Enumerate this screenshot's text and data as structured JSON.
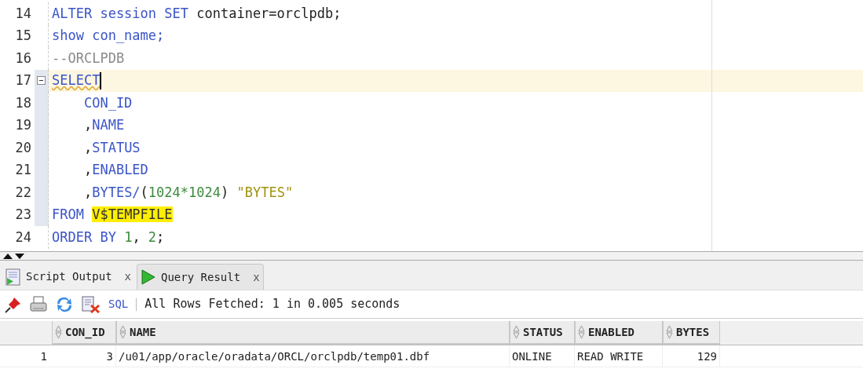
{
  "editor": {
    "lines": [
      {
        "number": "14",
        "current": false,
        "fold": false,
        "in_block": false,
        "tokens": [
          {
            "kind": "keyword",
            "text": "ALTER session SET "
          },
          {
            "kind": "plain",
            "text": "container=orclpdb;"
          }
        ]
      },
      {
        "number": "15",
        "current": false,
        "fold": false,
        "in_block": false,
        "tokens": [
          {
            "kind": "keyword",
            "text": "show con_name;"
          }
        ]
      },
      {
        "number": "16",
        "current": false,
        "fold": false,
        "in_block": false,
        "tokens": [
          {
            "kind": "comment",
            "text": "--ORCLPDB"
          }
        ]
      },
      {
        "number": "17",
        "current": true,
        "fold": true,
        "in_block": true,
        "tokens": [
          {
            "kind": "squiggle",
            "text": "SELECT"
          }
        ]
      },
      {
        "number": "18",
        "current": false,
        "fold": false,
        "in_block": true,
        "tokens": [
          {
            "kind": "keyword",
            "text": "    CON_ID"
          }
        ]
      },
      {
        "number": "19",
        "current": false,
        "fold": false,
        "in_block": true,
        "tokens": [
          {
            "kind": "plain",
            "text": "    ,"
          },
          {
            "kind": "keyword",
            "text": "NAME"
          }
        ]
      },
      {
        "number": "20",
        "current": false,
        "fold": false,
        "in_block": true,
        "tokens": [
          {
            "kind": "plain",
            "text": "    ,"
          },
          {
            "kind": "keyword",
            "text": "STATUS"
          }
        ]
      },
      {
        "number": "21",
        "current": false,
        "fold": false,
        "in_block": true,
        "tokens": [
          {
            "kind": "plain",
            "text": "    ,"
          },
          {
            "kind": "keyword",
            "text": "ENABLED"
          }
        ]
      },
      {
        "number": "22",
        "current": false,
        "fold": false,
        "in_block": true,
        "tokens": [
          {
            "kind": "plain",
            "text": "    ,"
          },
          {
            "kind": "keyword",
            "text": "BYTES/"
          },
          {
            "kind": "plain",
            "text": "("
          },
          {
            "kind": "number",
            "text": "1024*1024"
          },
          {
            "kind": "plain",
            "text": ") "
          },
          {
            "kind": "string",
            "text": "\"BYTES\""
          }
        ]
      },
      {
        "number": "23",
        "current": false,
        "fold": false,
        "in_block": true,
        "tokens": [
          {
            "kind": "keyword",
            "text": "FROM "
          },
          {
            "kind": "highlight",
            "text": "V$TEMPFILE"
          }
        ]
      },
      {
        "number": "24",
        "current": false,
        "fold": false,
        "in_block": false,
        "tokens": [
          {
            "kind": "keyword",
            "text": "ORDER BY "
          },
          {
            "kind": "number",
            "text": "1"
          },
          {
            "kind": "plain",
            "text": ", "
          },
          {
            "kind": "number",
            "text": "2"
          },
          {
            "kind": "plain",
            "text": ";"
          }
        ]
      }
    ]
  },
  "tabs": [
    {
      "label": "Script Output",
      "close": "x",
      "selected": false,
      "kind": "script"
    },
    {
      "label": "Query Result",
      "close": "x",
      "selected": true,
      "kind": "query"
    }
  ],
  "toolbar": {
    "sql": "SQL",
    "status": "All Rows Fetched: 1 in 0.005 seconds"
  },
  "table": {
    "columns": [
      "CON_ID",
      "NAME",
      "STATUS",
      "ENABLED",
      "BYTES"
    ],
    "rows": [
      {
        "number": "1",
        "cells": [
          "3",
          "/u01/app/oracle/oradata/ORCL/orclpdb/temp01.dbf",
          "ONLINE",
          "READ WRITE",
          "129"
        ]
      }
    ]
  }
}
